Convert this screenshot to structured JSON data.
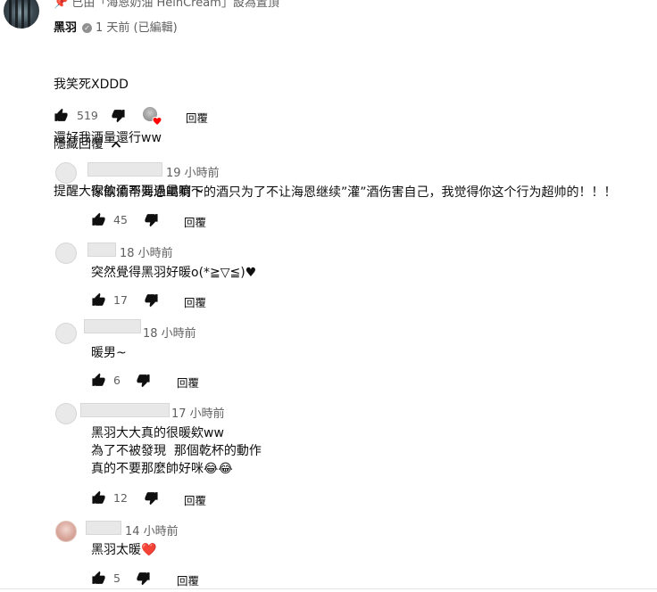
{
  "pinned_text": "已由「海恩奶油 HeinCream」設為置頂",
  "main_comment": {
    "author": "黑羽",
    "time": "1 天前 (已編輯)",
    "lines": [
      "我笑死XDDD",
      "還好我酒量還行ww",
      "提醒大家飲酒不要過量唷～"
    ],
    "likes": "519",
    "reply_label": "回覆"
  },
  "hide_replies_label": "隱藏回覆",
  "replies": [
    {
      "time": "19 小時前",
      "text": "你偷偷帮海恩喝剩下的酒只为了不让海恩继续”灌”酒伤害自己，我觉得你这个行为超帅的！！！",
      "likes": "45",
      "reply_label": "回覆"
    },
    {
      "time": "18 小時前",
      "text": "突然覺得黑羽好暖o(*≧▽≦)♥",
      "likes": "17",
      "reply_label": "回覆"
    },
    {
      "time": "18 小時前",
      "text": "暖男~",
      "likes": "6",
      "reply_label": "回覆"
    },
    {
      "time": "17 小時前",
      "text": "黑羽大大真的很暖欸ww\n為了不被發現  那個乾杯的動作\n真的不要那麼帥好咪😂😂",
      "likes": "12",
      "reply_label": "回覆"
    },
    {
      "time": "14 小時前",
      "text": "黑羽太暖❤️",
      "likes": "5",
      "reply_label": "回覆"
    }
  ],
  "colors": {
    "secondary_text": "#606060",
    "primary_text": "#0f0f0f",
    "heart": "#ff0000"
  }
}
